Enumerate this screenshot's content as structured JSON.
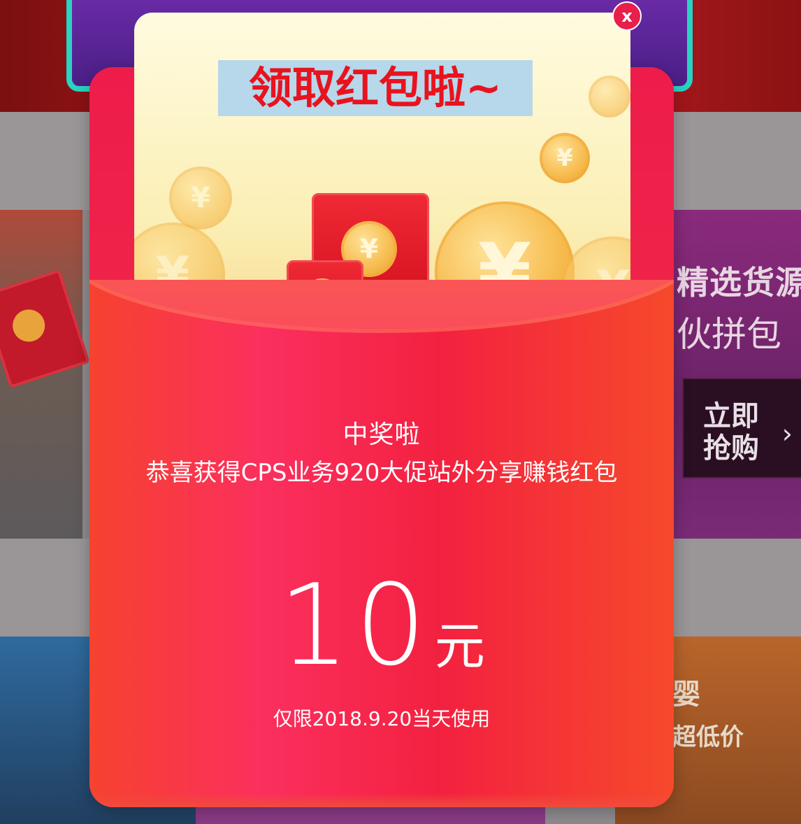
{
  "background": {
    "right_card": {
      "title": "精选货源",
      "subtitle": "伙拼包",
      "button_label": "立即抢购",
      "chevron": "›"
    },
    "lower_right_card": {
      "title": "婴",
      "subtitle": "超低价"
    }
  },
  "modal": {
    "headline": "领取红包啦~",
    "close_label": "x",
    "win_title": "中奖啦",
    "win_subtitle": "恭喜获得CPS业务920大促站外分享赚钱红包",
    "amount": {
      "value": "10",
      "unit": "元"
    },
    "valid_note": "仅限2018.9.20当天使用",
    "coin_symbol": "¥",
    "icons": [
      "close-icon",
      "coin-icon",
      "red-envelope-icon"
    ],
    "colors": {
      "accent": "#e81e4b",
      "envelope_red": "#f32140",
      "letter_cream": "#fbefb5",
      "headline_bg": "#b7d7ea",
      "headline_text": "#e8131f"
    }
  }
}
